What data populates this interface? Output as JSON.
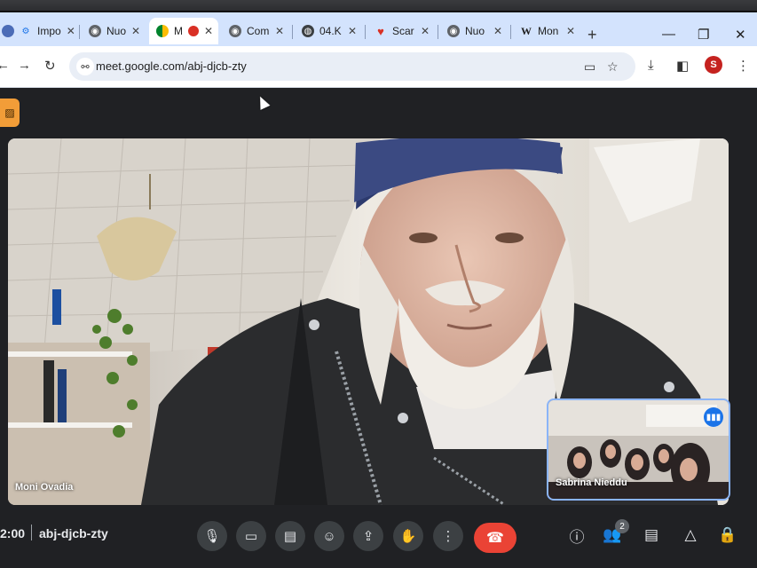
{
  "browser": {
    "tabs": [
      {
        "label": "Impo",
        "icon": "gear-icon",
        "active": false
      },
      {
        "label": "Nuo",
        "icon": "chrome-icon",
        "active": false
      },
      {
        "label": "M",
        "icon": "meet-icon",
        "active": true
      },
      {
        "label": "Com",
        "icon": "chrome-icon",
        "active": false
      },
      {
        "label": "04.K",
        "icon": "globe-icon",
        "active": false
      },
      {
        "label": "Scar",
        "icon": "heart-icon",
        "active": false
      },
      {
        "label": "Nuo",
        "icon": "chrome-icon",
        "active": false
      },
      {
        "label": "Mon",
        "icon": "wikipedia-icon",
        "active": false
      }
    ],
    "new_tab": "+",
    "url": "meet.google.com/abj-djcb-zty",
    "profile_initial": "S"
  },
  "meeting": {
    "main_participant": "Moni Ovadia",
    "secondary_participant": "Sabrina Nieddu",
    "clock": "2:00",
    "meeting_code": "abj-djcb-zty",
    "people_count": "2"
  },
  "colors": {
    "accent": "#1a73e8",
    "hangup": "#ea4335",
    "tabstrip": "#d3e3fd",
    "camera_off_badge": "#f29d38"
  }
}
